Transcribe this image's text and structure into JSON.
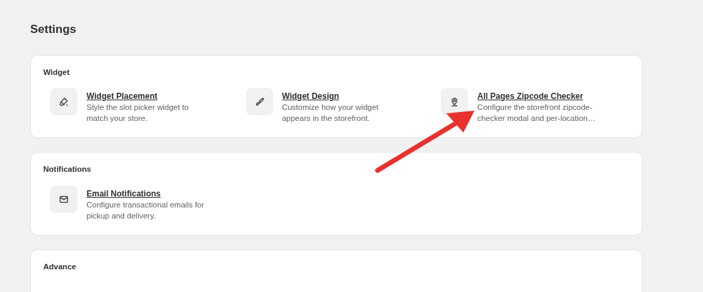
{
  "page_title": "Settings",
  "sections": [
    {
      "title": "Widget",
      "items": [
        {
          "title": "Widget Placement",
          "description": "Style the slot picker widget to match your store."
        },
        {
          "title": "Widget Design",
          "description": "Customize how your widget appears in the storefront."
        },
        {
          "title": "All Pages Zipcode Checker",
          "description": "Configure the storefront zipcode-checker modal and per-location…"
        }
      ]
    },
    {
      "title": "Notifications",
      "items": [
        {
          "title": "Email Notifications",
          "description": "Configure transactional emails for pickup and delivery."
        }
      ]
    },
    {
      "title": "Advance"
    }
  ]
}
